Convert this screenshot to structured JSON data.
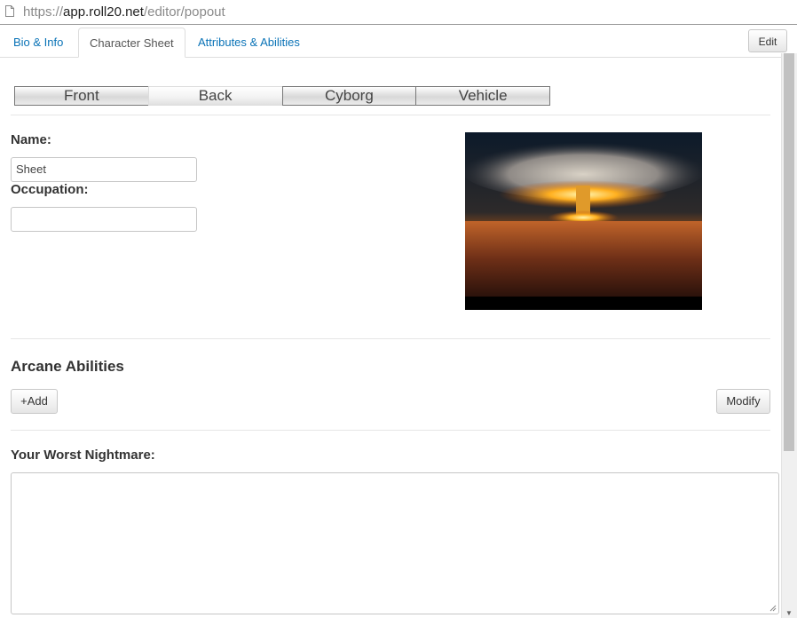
{
  "browser": {
    "url_protocol": "https://",
    "url_host": "app.roll20.net",
    "url_path": "/editor/popout"
  },
  "tabs": [
    {
      "label": "Bio & Info",
      "active": false
    },
    {
      "label": "Character Sheet",
      "active": true
    },
    {
      "label": "Attributes & Abilities",
      "active": false
    }
  ],
  "edit_label": "Edit",
  "sheet_tabs": [
    {
      "label": "Front"
    },
    {
      "label": "Back"
    },
    {
      "label": "Cyborg"
    },
    {
      "label": "Vehicle"
    }
  ],
  "selected_sheet_tab": "Back",
  "fields": {
    "name_label": "Name:",
    "name_value": "Sheet",
    "occupation_label": "Occupation:",
    "occupation_value": ""
  },
  "portrait": {
    "icon": "mushroom-cloud-image"
  },
  "arcane": {
    "title": "Arcane Abilities",
    "add_label": "+Add",
    "modify_label": "Modify"
  },
  "nightmare": {
    "label": "Your Worst Nightmare:",
    "value": ""
  },
  "colors": {
    "link": "#0a73b7",
    "text": "#333333",
    "border": "#c6c6c6"
  }
}
